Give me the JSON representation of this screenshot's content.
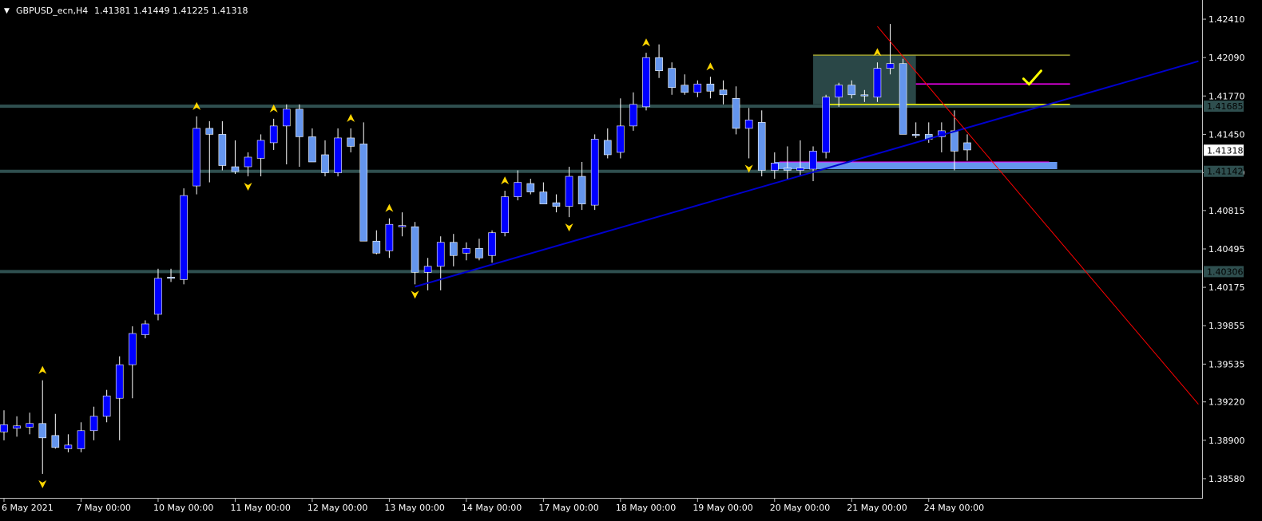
{
  "header": {
    "symbol": "GBPUSD_ecn,H4",
    "ohlc": "1.41381 1.41449 1.41225 1.41318",
    "dropdown_glyph": "▼"
  },
  "colors": {
    "background": "#000000",
    "bull_body": "#0000ff",
    "bear_body": "#6495ed",
    "wick": "#ffffff",
    "level_line": "#2f4f4f",
    "trendline": "#0000cd",
    "downline": "#ff0000",
    "fractal": "#ffd700",
    "rect_fill": "#2f4f4f",
    "rect_edge": "#a0a030",
    "fib_magenta": "#ff00ff",
    "fib_yellow": "#ffff00",
    "check_mark": "#ffff00",
    "grid_axis": "#c0c0c0",
    "level_tag_bg": "#2f4f4f",
    "price_tag_bg": "#ffffff"
  },
  "chart_data": {
    "type": "candlestick",
    "title": "GBPUSD_ecn,H4",
    "timeframe": "H4",
    "y_range": [
      1.3842,
      1.4257
    ],
    "y_ticks": [
      "1.42410",
      "1.42090",
      "1.41770",
      "1.41450",
      "1.41130",
      "1.40815",
      "1.40495",
      "1.40175",
      "1.39855",
      "1.39535",
      "1.39220",
      "1.38900",
      "1.38580"
    ],
    "x_labels": [
      "6 May 2021",
      "7 May 00:00",
      "10 May 00:00",
      "11 May 00:00",
      "12 May 00:00",
      "13 May 00:00",
      "14 May 00:00",
      "17 May 00:00",
      "18 May 00:00",
      "19 May 00:00",
      "20 May 00:00",
      "21 May 00:00",
      "24 May 00:00"
    ],
    "x_label_bars": [
      0,
      6,
      12,
      18,
      24,
      30,
      36,
      42,
      48,
      54,
      60,
      66,
      72
    ],
    "current_price": "1.41318",
    "levels": [
      {
        "price": 1.41685,
        "label": "1.41685"
      },
      {
        "price": 1.41142,
        "label": "1.41142"
      },
      {
        "price": 1.40306,
        "label": "1.40306"
      }
    ],
    "candles": [
      {
        "o": 1.3897,
        "h": 1.3915,
        "l": 1.389,
        "c": 1.3903
      },
      {
        "o": 1.39,
        "h": 1.391,
        "l": 1.3893,
        "c": 1.3902
      },
      {
        "o": 1.3901,
        "h": 1.3913,
        "l": 1.3895,
        "c": 1.3904
      },
      {
        "o": 1.3904,
        "h": 1.394,
        "l": 1.3862,
        "c": 1.3892
      },
      {
        "o": 1.3894,
        "h": 1.3912,
        "l": 1.3883,
        "c": 1.3884
      },
      {
        "o": 1.3883,
        "h": 1.3895,
        "l": 1.388,
        "c": 1.3886
      },
      {
        "o": 1.3883,
        "h": 1.3905,
        "l": 1.388,
        "c": 1.3898
      },
      {
        "o": 1.3898,
        "h": 1.3918,
        "l": 1.389,
        "c": 1.391
      },
      {
        "o": 1.391,
        "h": 1.3932,
        "l": 1.3905,
        "c": 1.3927
      },
      {
        "o": 1.3925,
        "h": 1.396,
        "l": 1.389,
        "c": 1.3953
      },
      {
        "o": 1.3953,
        "h": 1.3985,
        "l": 1.3925,
        "c": 1.3979
      },
      {
        "o": 1.3978,
        "h": 1.399,
        "l": 1.3975,
        "c": 1.3987
      },
      {
        "o": 1.3995,
        "h": 1.4033,
        "l": 1.399,
        "c": 1.4025
      },
      {
        "o": 1.4026,
        "h": 1.4033,
        "l": 1.4022,
        "c": 1.4025
      },
      {
        "o": 1.4024,
        "h": 1.41,
        "l": 1.402,
        "c": 1.4094
      },
      {
        "o": 1.4102,
        "h": 1.416,
        "l": 1.4095,
        "c": 1.415
      },
      {
        "o": 1.415,
        "h": 1.4156,
        "l": 1.4105,
        "c": 1.4145
      },
      {
        "o": 1.4145,
        "h": 1.4156,
        "l": 1.4115,
        "c": 1.4119
      },
      {
        "o": 1.4118,
        "h": 1.414,
        "l": 1.4112,
        "c": 1.4114
      },
      {
        "o": 1.4118,
        "h": 1.413,
        "l": 1.411,
        "c": 1.4126
      },
      {
        "o": 1.4125,
        "h": 1.4145,
        "l": 1.411,
        "c": 1.414
      },
      {
        "o": 1.4138,
        "h": 1.4158,
        "l": 1.4132,
        "c": 1.4152
      },
      {
        "o": 1.4152,
        "h": 1.417,
        "l": 1.412,
        "c": 1.4166
      },
      {
        "o": 1.4166,
        "h": 1.417,
        "l": 1.4118,
        "c": 1.4143
      },
      {
        "o": 1.4143,
        "h": 1.415,
        "l": 1.4122,
        "c": 1.4122
      },
      {
        "o": 1.4128,
        "h": 1.414,
        "l": 1.411,
        "c": 1.4113
      },
      {
        "o": 1.4113,
        "h": 1.415,
        "l": 1.411,
        "c": 1.4142
      },
      {
        "o": 1.4142,
        "h": 1.415,
        "l": 1.413,
        "c": 1.4135
      },
      {
        "o": 1.4137,
        "h": 1.4155,
        "l": 1.4056,
        "c": 1.4056
      },
      {
        "o": 1.4056,
        "h": 1.4065,
        "l": 1.4045,
        "c": 1.4046
      },
      {
        "o": 1.4048,
        "h": 1.4075,
        "l": 1.4042,
        "c": 1.407
      },
      {
        "o": 1.4069,
        "h": 1.408,
        "l": 1.406,
        "c": 1.4069
      },
      {
        "o": 1.4068,
        "h": 1.4072,
        "l": 1.402,
        "c": 1.403
      },
      {
        "o": 1.403,
        "h": 1.4042,
        "l": 1.4015,
        "c": 1.4035
      },
      {
        "o": 1.4035,
        "h": 1.406,
        "l": 1.4015,
        "c": 1.4055
      },
      {
        "o": 1.4055,
        "h": 1.4062,
        "l": 1.4035,
        "c": 1.4044
      },
      {
        "o": 1.4046,
        "h": 1.4055,
        "l": 1.404,
        "c": 1.405
      },
      {
        "o": 1.405,
        "h": 1.4058,
        "l": 1.404,
        "c": 1.4042
      },
      {
        "o": 1.4044,
        "h": 1.4065,
        "l": 1.4038,
        "c": 1.4063
      },
      {
        "o": 1.4063,
        "h": 1.4098,
        "l": 1.406,
        "c": 1.4093
      },
      {
        "o": 1.4093,
        "h": 1.4115,
        "l": 1.409,
        "c": 1.4105
      },
      {
        "o": 1.4104,
        "h": 1.4108,
        "l": 1.4095,
        "c": 1.4097
      },
      {
        "o": 1.4097,
        "h": 1.4105,
        "l": 1.4088,
        "c": 1.4087
      },
      {
        "o": 1.4088,
        "h": 1.4095,
        "l": 1.408,
        "c": 1.4085
      },
      {
        "o": 1.4085,
        "h": 1.4118,
        "l": 1.4076,
        "c": 1.411
      },
      {
        "o": 1.411,
        "h": 1.4122,
        "l": 1.4082,
        "c": 1.4087
      },
      {
        "o": 1.4086,
        "h": 1.4145,
        "l": 1.4082,
        "c": 1.4141
      },
      {
        "o": 1.414,
        "h": 1.415,
        "l": 1.4125,
        "c": 1.4128
      },
      {
        "o": 1.413,
        "h": 1.4175,
        "l": 1.4125,
        "c": 1.4152
      },
      {
        "o": 1.4152,
        "h": 1.418,
        "l": 1.4148,
        "c": 1.417
      },
      {
        "o": 1.4168,
        "h": 1.4213,
        "l": 1.4165,
        "c": 1.4209
      },
      {
        "o": 1.4209,
        "h": 1.422,
        "l": 1.4192,
        "c": 1.4198
      },
      {
        "o": 1.42,
        "h": 1.4205,
        "l": 1.4178,
        "c": 1.4184
      },
      {
        "o": 1.4186,
        "h": 1.4195,
        "l": 1.4178,
        "c": 1.418
      },
      {
        "o": 1.418,
        "h": 1.419,
        "l": 1.4176,
        "c": 1.4187
      },
      {
        "o": 1.4187,
        "h": 1.4193,
        "l": 1.4175,
        "c": 1.4181
      },
      {
        "o": 1.4182,
        "h": 1.419,
        "l": 1.417,
        "c": 1.4178
      },
      {
        "o": 1.4175,
        "h": 1.4185,
        "l": 1.4145,
        "c": 1.415
      },
      {
        "o": 1.415,
        "h": 1.4167,
        "l": 1.4125,
        "c": 1.4157
      },
      {
        "o": 1.4155,
        "h": 1.4165,
        "l": 1.411,
        "c": 1.4115
      },
      {
        "o": 1.4115,
        "h": 1.413,
        "l": 1.4108,
        "c": 1.4121
      },
      {
        "o": 1.4117,
        "h": 1.4135,
        "l": 1.4108,
        "c": 1.4115
      },
      {
        "o": 1.4115,
        "h": 1.414,
        "l": 1.411,
        "c": 1.4117
      },
      {
        "o": 1.4116,
        "h": 1.4135,
        "l": 1.4106,
        "c": 1.4131
      },
      {
        "o": 1.413,
        "h": 1.4178,
        "l": 1.4125,
        "c": 1.4176
      },
      {
        "o": 1.4176,
        "h": 1.4188,
        "l": 1.4168,
        "c": 1.4186
      },
      {
        "o": 1.4186,
        "h": 1.419,
        "l": 1.4175,
        "c": 1.4178
      },
      {
        "o": 1.4178,
        "h": 1.4182,
        "l": 1.4172,
        "c": 1.4177
      },
      {
        "o": 1.4176,
        "h": 1.4205,
        "l": 1.4172,
        "c": 1.42
      },
      {
        "o": 1.42,
        "h": 1.4237,
        "l": 1.4195,
        "c": 1.4204
      },
      {
        "o": 1.4204,
        "h": 1.4208,
        "l": 1.4145,
        "c": 1.4145
      },
      {
        "o": 1.4145,
        "h": 1.4155,
        "l": 1.4142,
        "c": 1.4144
      },
      {
        "o": 1.4145,
        "h": 1.4155,
        "l": 1.4138,
        "c": 1.4141
      },
      {
        "o": 1.4143,
        "h": 1.4155,
        "l": 1.413,
        "c": 1.4148
      },
      {
        "o": 1.4148,
        "h": 1.4165,
        "l": 1.4115,
        "c": 1.4131
      },
      {
        "o": 1.4138,
        "h": 1.4145,
        "l": 1.4123,
        "c": 1.4132
      }
    ],
    "fractals_up": [
      3,
      15,
      21,
      27,
      30,
      39,
      50,
      55,
      68
    ],
    "fractals_down": [
      3,
      19,
      32,
      44,
      58
    ],
    "trendline": {
      "from": {
        "bar": 32,
        "price": 1.4018
      },
      "to": {
        "bar": 93,
        "price": 1.4206
      }
    },
    "downline": {
      "from": {
        "bar": 68,
        "price": 1.4235
      },
      "to": {
        "bar": 93,
        "price": 1.392
      }
    },
    "zone_rect": {
      "bar_from": 63,
      "bar_to": 71,
      "top": 1.4211,
      "bottom": 1.417
    },
    "fib_lines": [
      {
        "price": 1.4211,
        "bar_from": 63,
        "bar_to": 83,
        "color_key": "rect_edge"
      },
      {
        "price": 1.4187,
        "bar_from": 71,
        "bar_to": 83,
        "color_key": "fib_magenta"
      },
      {
        "price": 1.417,
        "bar_from": 64,
        "bar_to": 83,
        "color_key": "fib_yellow"
      }
    ],
    "check_mark": {
      "bar": 80,
      "price": 1.4192
    },
    "support_band": {
      "bar_from": 60,
      "bar_to": 82,
      "top": 1.4122,
      "bottom": 1.4116
    },
    "support_band_line": {
      "price": 1.4122
    }
  }
}
